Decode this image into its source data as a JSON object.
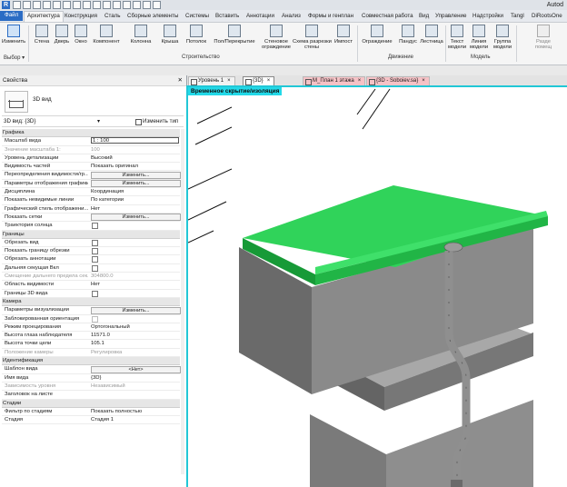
{
  "title_bar": {
    "title": "Autod"
  },
  "ribbon_tabs": [
    {
      "label": "Файл"
    },
    {
      "label": "Архитектура"
    },
    {
      "label": "Конструкция"
    },
    {
      "label": "Сталь"
    },
    {
      "label": "Сборные элементы"
    },
    {
      "label": "Системы"
    },
    {
      "label": "Вставить"
    },
    {
      "label": "Аннотации"
    },
    {
      "label": "Анализ"
    },
    {
      "label": "Формы и генплан"
    },
    {
      "label": "Совместная работа"
    },
    {
      "label": "Вид"
    },
    {
      "label": "Управление"
    },
    {
      "label": "Надстройки"
    },
    {
      "label": "Tangl"
    },
    {
      "label": "DiRootsOne"
    }
  ],
  "ribbon": {
    "buttons": [
      {
        "label": "Изменить"
      },
      {
        "label": "Стена"
      },
      {
        "label": "Дверь"
      },
      {
        "label": "Окно"
      },
      {
        "label": "Компонент"
      },
      {
        "label": "Колонна"
      },
      {
        "label": "Крыша"
      },
      {
        "label": "Потолок"
      },
      {
        "label": "Пол/Перекрытие"
      },
      {
        "label": "Стеновое\nограждение"
      },
      {
        "label": "Схема разрезки\nстены"
      },
      {
        "label": "Импост"
      },
      {
        "label": "Ограждение"
      },
      {
        "label": "Пандус"
      },
      {
        "label": "Лестница"
      },
      {
        "label": "Текст\nмодели"
      },
      {
        "label": "Линия\nмодели"
      },
      {
        "label": "Группа\nмодели"
      },
      {
        "label": "Разде\nпомещ"
      }
    ],
    "panels": {
      "select": "Выбор ▾",
      "build": "Строительство",
      "circulation": "Движение",
      "model": "Модель"
    }
  },
  "view_tabs": [
    {
      "label": "Уровень 1"
    },
    {
      "label": "{3D}"
    },
    {
      "label": "М_План 1 этажа"
    },
    {
      "label": "{3D - Soboiev.sa}"
    }
  ],
  "properties": {
    "title": "Свойства",
    "type_name": "3D вид",
    "selector": "3D вид: {3D}",
    "edit_type": "Изменить тип",
    "rows": [
      {
        "k": "Графика",
        "kind": "section"
      },
      {
        "k": "Масштаб вида",
        "v": "1 : 100",
        "kind": "input"
      },
      {
        "k": "Значение масштаба    1:",
        "v": "100",
        "kind": "disabled"
      },
      {
        "k": "Уровень детализации",
        "v": "Высокий"
      },
      {
        "k": "Видимость частей",
        "v": "Показать оригинал"
      },
      {
        "k": "Переопределения видимости/гр...",
        "v": "Изменить...",
        "kind": "button"
      },
      {
        "k": "Параметры отображения графики",
        "v": "Изменить...",
        "kind": "button"
      },
      {
        "k": "Дисциплина",
        "v": "Координация"
      },
      {
        "k": "Показать невидимые линии",
        "v": "По категории"
      },
      {
        "k": "Графический стиль отображени...",
        "v": "Нет"
      },
      {
        "k": "Показать сетки",
        "v": "Изменить...",
        "kind": "button"
      },
      {
        "k": "Траектория солнца",
        "kind": "check"
      },
      {
        "k": "Границы",
        "kind": "section"
      },
      {
        "k": "Обрезать вид",
        "kind": "check"
      },
      {
        "k": "Показать границу обрезки",
        "kind": "check"
      },
      {
        "k": "Обрезать аннотации",
        "kind": "check"
      },
      {
        "k": "Дальняя секущая Вкл",
        "kind": "check"
      },
      {
        "k": "Смещение дальнего предела сек...",
        "v": "304800.0",
        "kind": "disabled"
      },
      {
        "k": "Область видимости",
        "v": "Нет"
      },
      {
        "k": "Границы 3D вида",
        "kind": "check"
      },
      {
        "k": "Камера",
        "kind": "section"
      },
      {
        "k": "Параметры визуализации",
        "v": "Изменить...",
        "kind": "button"
      },
      {
        "k": "Заблокированная ориентация",
        "kind": "check-disabled"
      },
      {
        "k": "Режим проецирования",
        "v": "Ортогональный"
      },
      {
        "k": "Высота глаза наблюдателя",
        "v": "11571.0"
      },
      {
        "k": "Высота точки цели",
        "v": "105.1"
      },
      {
        "k": "Положение камеры",
        "v": "Регулировка",
        "kind": "disabled"
      },
      {
        "k": "Идентификация",
        "kind": "section"
      },
      {
        "k": "Шаблон вида",
        "v": "<Нет>",
        "kind": "button"
      },
      {
        "k": "Имя вида",
        "v": "{3D}"
      },
      {
        "k": "Зависимость уровня",
        "v": "Независимый",
        "kind": "disabled"
      },
      {
        "k": "Заголовок на листе",
        "v": ""
      },
      {
        "k": "Стадии",
        "kind": "section"
      },
      {
        "k": "Фильтр по стадиям",
        "v": "Показать полностью"
      },
      {
        "k": "Стадия",
        "v": "Стадия 1"
      }
    ]
  },
  "viewport": {
    "banner": "Временное скрытие/изоляция",
    "colors": {
      "roof": "#27c04a",
      "roof_dark": "#1a8f33",
      "wall_front": "#8d8d8d",
      "wall_side": "#6c6c6c",
      "accent": "#22d9e8"
    }
  }
}
